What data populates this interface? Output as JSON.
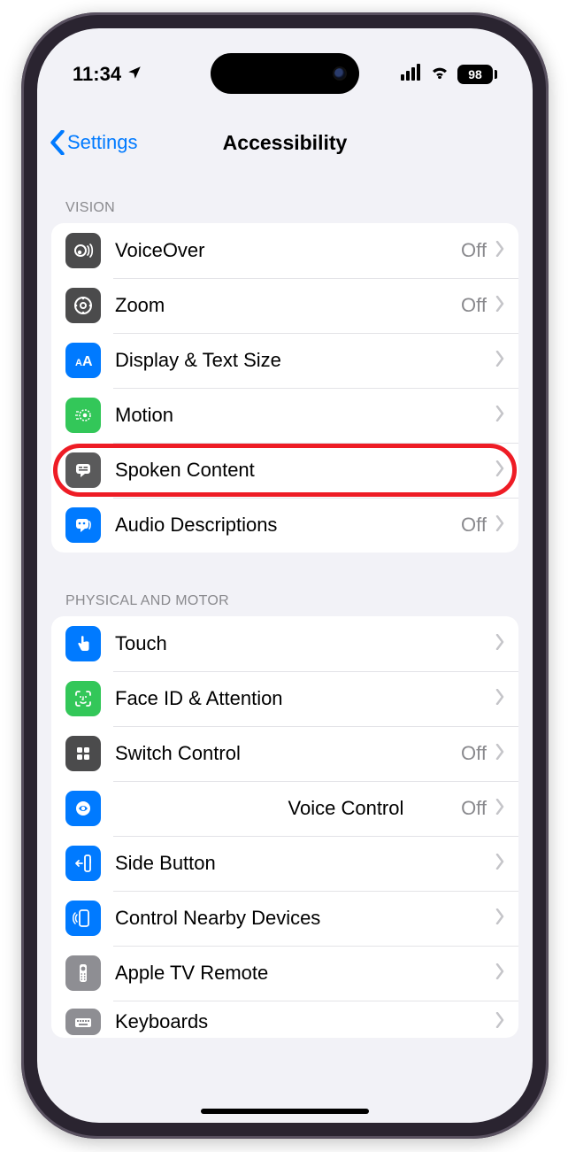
{
  "status": {
    "time": "11:34",
    "battery": "98"
  },
  "nav": {
    "back": "Settings",
    "title": "Accessibility"
  },
  "sections": {
    "vision": {
      "header": "VISION",
      "items": {
        "voiceover": {
          "label": "VoiceOver",
          "value": "Off"
        },
        "zoom": {
          "label": "Zoom",
          "value": "Off"
        },
        "display": {
          "label": "Display & Text Size"
        },
        "motion": {
          "label": "Motion"
        },
        "spoken": {
          "label": "Spoken Content"
        },
        "audiodesc": {
          "label": "Audio Descriptions",
          "value": "Off"
        }
      }
    },
    "physical": {
      "header": "PHYSICAL AND MOTOR",
      "items": {
        "touch": {
          "label": "Touch"
        },
        "faceid": {
          "label": "Face ID & Attention"
        },
        "switch": {
          "label": "Switch Control",
          "value": "Off"
        },
        "voicectl": {
          "label": "Voice Control",
          "value": "Off"
        },
        "sidebtn": {
          "label": "Side Button"
        },
        "nearby": {
          "label": "Control Nearby Devices"
        },
        "appletv": {
          "label": "Apple TV Remote"
        },
        "keyboards": {
          "label": "Keyboards"
        }
      }
    }
  },
  "highlighted_row": "spoken"
}
